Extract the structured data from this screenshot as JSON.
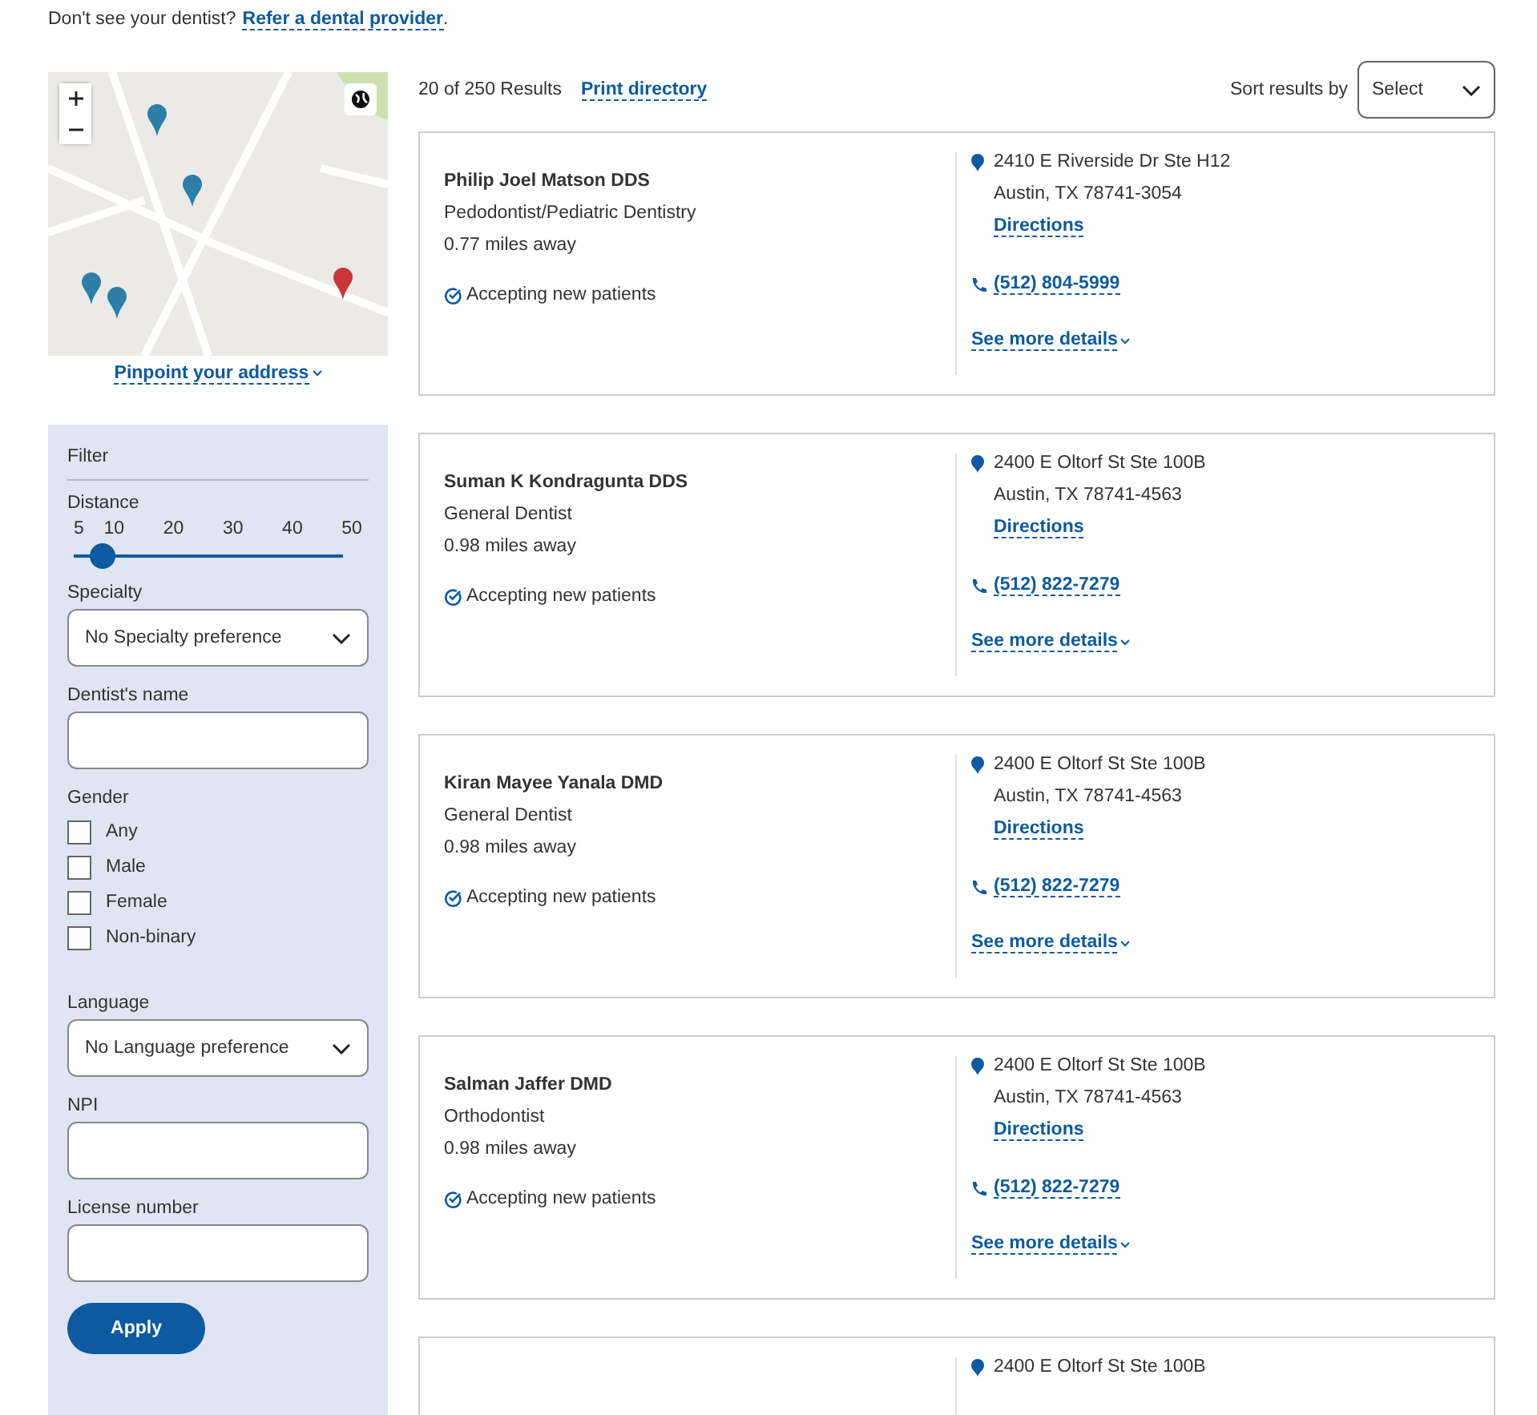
{
  "notice": {
    "text": "Don't see your dentist?",
    "link": "Refer a dental provider",
    "after": "."
  },
  "map": {
    "pinpoint_link": "Pinpoint your address"
  },
  "filter": {
    "title": "Filter",
    "distance": {
      "label": "Distance",
      "ticks": [
        "5",
        "10",
        "20",
        "30",
        "40",
        "50"
      ],
      "level": 0.11
    },
    "specialty": {
      "label": "Specialty",
      "value": "No Specialty preference"
    },
    "dentist_name": {
      "label": "Dentist's name"
    },
    "gender": {
      "label": "Gender",
      "options": [
        {
          "label": "Any",
          "checked": false
        },
        {
          "label": "Male",
          "checked": false
        },
        {
          "label": "Female",
          "checked": false
        },
        {
          "label": "Non-binary",
          "checked": false
        }
      ]
    },
    "language": {
      "label": "Language",
      "value": "No Language preference"
    },
    "npi": {
      "label": "NPI"
    },
    "license": {
      "label": "License number"
    },
    "apply": "Apply"
  },
  "results": {
    "count": "20 of 250 Results",
    "print_link": "Print directory",
    "sort_label": "Sort results by",
    "sort_value": "Select"
  },
  "providers": [
    {
      "name": "Philip Joel Matson DDS",
      "specialty": "Pedodontist/Pediatric Dentistry",
      "distance": "0.77 miles away",
      "accepting": "Accepting new patients",
      "address1": "2410 E Riverside Dr Ste H12",
      "address2": "Austin, TX 78741-3054",
      "directions": "Directions",
      "phone": "(512) 804-5999",
      "details": "See more details"
    },
    {
      "name": "Suman K Kondragunta DDS",
      "specialty": "General Dentist",
      "distance": "0.98 miles away",
      "accepting": "Accepting new patients",
      "address1": "2400 E Oltorf St Ste 100B",
      "address2": "Austin, TX 78741-4563",
      "directions": "Directions",
      "phone": "(512) 822-7279",
      "details": "See more details"
    },
    {
      "name": "Kiran Mayee Yanala DMD",
      "specialty": "General Dentist",
      "distance": "0.98 miles away",
      "accepting": "Accepting new patients",
      "address1": "2400 E Oltorf St Ste 100B",
      "address2": "Austin, TX 78741-4563",
      "directions": "Directions",
      "phone": "(512) 822-7279",
      "details": "See more details"
    },
    {
      "name": "Salman Jaffer DMD",
      "specialty": "Orthodontist",
      "distance": "0.98 miles away",
      "accepting": "Accepting new patients",
      "address1": "2400 E Oltorf St Ste 100B",
      "address2": "Austin, TX 78741-4563",
      "directions": "Directions",
      "phone": "(512) 822-7279",
      "details": "See more details"
    },
    {
      "address1": "2400 E Oltorf St Ste 100B"
    }
  ]
}
